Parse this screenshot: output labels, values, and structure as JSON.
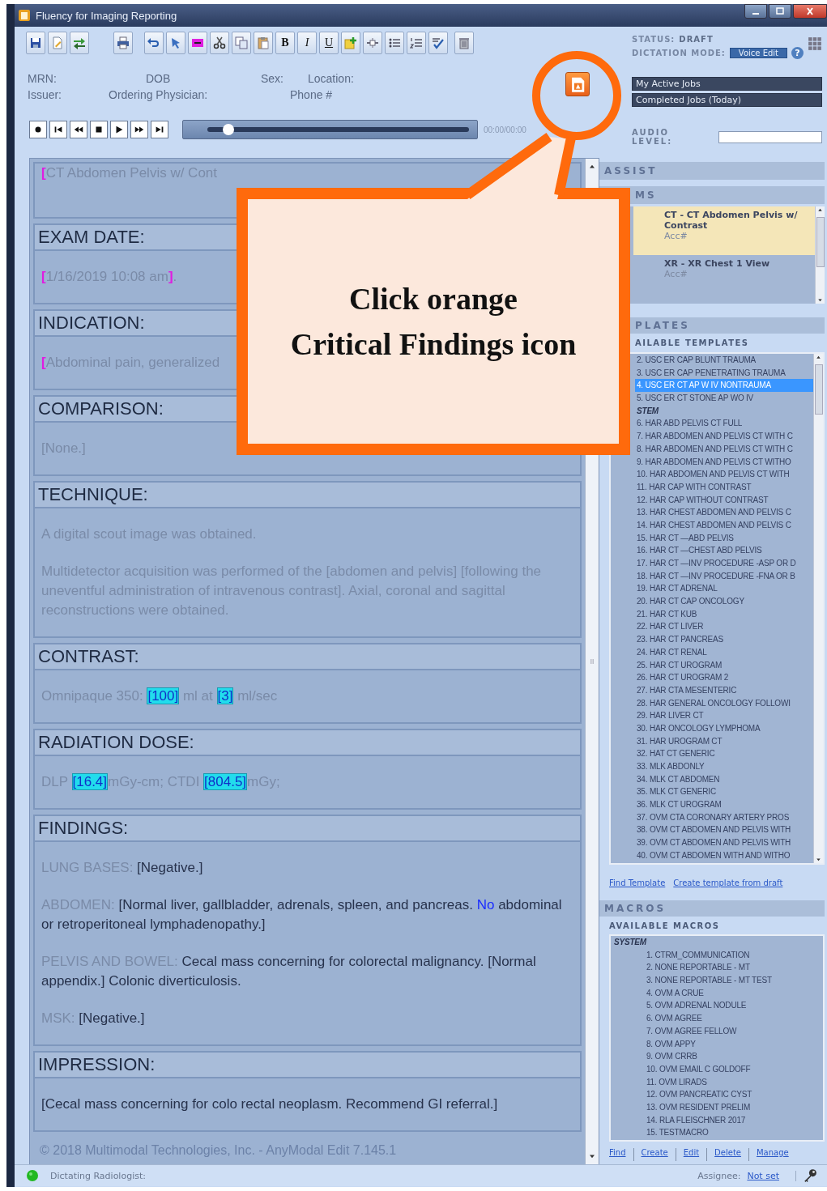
{
  "window": {
    "title": "Fluency for Imaging Reporting"
  },
  "toolbar": {
    "format_buttons": [
      "B",
      "I",
      "U"
    ]
  },
  "status": {
    "status_label": "STATUS:",
    "status_value": "DRAFT",
    "mode_label": "DICTATION MODE:",
    "mode_button": "Voice Edit",
    "help": "?"
  },
  "patient": {
    "rows": [
      [
        "MRN:",
        "DOB",
        "Sex:",
        "Location:"
      ],
      [
        "Issuer:",
        "Ordering Physician:",
        "Phone #"
      ]
    ]
  },
  "jobs": [
    {
      "label": "My Active Jobs"
    },
    {
      "label": "Completed Jobs (Today)"
    }
  ],
  "transport": {
    "level": 0.08,
    "time": "00:00/00:00"
  },
  "audio": {
    "label": "AUDIO LEVEL:"
  },
  "editor": {
    "title": [
      {
        "kind": "marker",
        "text": "["
      },
      {
        "kind": "prompt",
        "text": "CT Abdomen Pelvis w/ Cont"
      }
    ],
    "sections": [
      {
        "heading": "EXAM DATE:",
        "paragraphs": [
          [
            {
              "kind": "marker",
              "text": "["
            },
            {
              "kind": "prompt",
              "text": "1/16/2019 10:08 am"
            },
            {
              "kind": "marker",
              "text": "]"
            },
            {
              "kind": "prompt",
              "text": "."
            }
          ]
        ]
      },
      {
        "heading": "INDICATION:",
        "paragraphs": [
          [
            {
              "kind": "marker",
              "text": "["
            },
            {
              "kind": "prompt",
              "text": "Abdominal pain, generalized"
            }
          ]
        ]
      },
      {
        "heading": "COMPARISON:",
        "paragraphs": [
          [
            {
              "kind": "prompt",
              "text": "[None.]"
            }
          ]
        ]
      },
      {
        "heading": "TECHNIQUE:",
        "paragraphs": [
          [
            {
              "kind": "prompt",
              "text": "A digital scout image was obtained."
            }
          ],
          [
            {
              "kind": "prompt",
              "text": "Multidetector acquisition was performed of the [abdomen and pelvis] [following the uneventful administration of intravenous contrast].  Axial, coronal and sagittal reconstructions were obtained."
            }
          ]
        ]
      },
      {
        "heading": "CONTRAST:",
        "paragraphs": [
          [
            {
              "kind": "prompt",
              "text": "Omnipaque 350: "
            },
            {
              "kind": "box",
              "text": "[100]"
            },
            {
              "kind": "prompt",
              "text": " ml at "
            },
            {
              "kind": "box",
              "text": "[3]"
            },
            {
              "kind": "prompt",
              "text": " ml/sec"
            }
          ]
        ]
      },
      {
        "heading": "RADIATION DOSE:",
        "paragraphs": [
          [
            {
              "kind": "prompt",
              "text": "DLP "
            },
            {
              "kind": "box",
              "text": "[16.4]"
            },
            {
              "kind": "prompt",
              "text": "mGy-cm; CTDI "
            },
            {
              "kind": "box",
              "text": "[804.5]"
            },
            {
              "kind": "prompt",
              "text": "mGy;"
            }
          ]
        ]
      },
      {
        "heading": "FINDINGS:",
        "paragraphs": [
          [
            {
              "kind": "prompt",
              "text": "LUNG BASES: "
            },
            {
              "kind": "value",
              "text": "[Negative.]"
            }
          ],
          [
            {
              "kind": "prompt",
              "text": "ABDOMEN: "
            },
            {
              "kind": "value",
              "text": "[Normal liver, gallbladder, adrenals, spleen, and pancreas.  "
            },
            {
              "kind": "accent",
              "text": "No"
            },
            {
              "kind": "value",
              "text": " abdominal or retroperitoneal lymphadenopathy.]"
            }
          ],
          [
            {
              "kind": "prompt",
              "text": "PELVIS AND BOWEL: "
            },
            {
              "kind": "value",
              "text": "Cecal mass concerning for colorectal malignancy. [Normal appendix.]  Colonic diverticulosis."
            }
          ],
          [
            {
              "kind": "prompt",
              "text": "MSK: "
            },
            {
              "kind": "value",
              "text": "[Negative.]"
            }
          ]
        ]
      },
      {
        "heading": "IMPRESSION:",
        "paragraphs": [
          [
            {
              "kind": "value",
              "text": "[Cecal mass concerning for colo rectal neoplasm.  Recommend GI referral.]"
            }
          ]
        ]
      }
    ],
    "footer": "© 2018 Multimodal Technologies, Inc. - AnyModal Edit 7.145.1"
  },
  "assist": {
    "header": "ASSIST",
    "exams_header": "MS",
    "exams": [
      {
        "title": "CT - CT Abdomen Pelvis w/ Contrast",
        "acc": "Acc#",
        "selected": true
      },
      {
        "title": "XR - XR Chest 1 View",
        "acc": "Acc#",
        "selected": false
      }
    ],
    "templates_header": "PLATES",
    "available_label": "AILABLE TEMPLATES",
    "templates": [
      {
        "kind": "item",
        "text": "2. USC ER CAP BLUNT TRAUMA",
        "selected": false
      },
      {
        "kind": "item",
        "text": "3. USC ER CAP PENETRATING TRAUMA",
        "selected": false
      },
      {
        "kind": "item",
        "text": "4. USC ER CT AP W IV NONTRAUMA",
        "selected": true
      },
      {
        "kind": "item",
        "text": "5. USC ER CT STONE AP WO IV",
        "selected": false
      },
      {
        "kind": "group",
        "text": "STEM"
      },
      {
        "kind": "item",
        "text": "6. HAR ABD PELVIS CT FULL",
        "selected": false
      },
      {
        "kind": "item",
        "text": "7. HAR ABDOMEN AND PELVIS CT WITH C",
        "selected": false
      },
      {
        "kind": "item",
        "text": "8. HAR ABDOMEN AND PELVIS CT WITH C",
        "selected": false
      },
      {
        "kind": "item",
        "text": "9. HAR ABDOMEN AND PELVIS CT WITHO",
        "selected": false
      },
      {
        "kind": "item",
        "text": "10. HAR ABDOMEN AND PELVIS CT WITH",
        "selected": false
      },
      {
        "kind": "item",
        "text": "11. HAR CAP WITH CONTRAST",
        "selected": false
      },
      {
        "kind": "item",
        "text": "12. HAR CAP WITHOUT CONTRAST",
        "selected": false
      },
      {
        "kind": "item",
        "text": "13. HAR CHEST ABDOMEN AND PELVIS C",
        "selected": false
      },
      {
        "kind": "item",
        "text": "14. HAR CHEST ABDOMEN AND PELVIS C",
        "selected": false
      },
      {
        "kind": "item",
        "text": "15. HAR CT —ABD PELVIS",
        "selected": false
      },
      {
        "kind": "item",
        "text": "16. HAR CT —CHEST ABD PELVIS",
        "selected": false
      },
      {
        "kind": "item",
        "text": "17. HAR CT —INV PROCEDURE -ASP OR D",
        "selected": false
      },
      {
        "kind": "item",
        "text": "18. HAR CT —INV PROCEDURE -FNA OR B",
        "selected": false
      },
      {
        "kind": "item",
        "text": "19. HAR CT ADRENAL",
        "selected": false
      },
      {
        "kind": "item",
        "text": "20. HAR CT CAP ONCOLOGY",
        "selected": false
      },
      {
        "kind": "item",
        "text": "21. HAR CT KUB",
        "selected": false
      },
      {
        "kind": "item",
        "text": "22. HAR CT LIVER",
        "selected": false
      },
      {
        "kind": "item",
        "text": "23. HAR CT PANCREAS",
        "selected": false
      },
      {
        "kind": "item",
        "text": "24. HAR CT RENAL",
        "selected": false
      },
      {
        "kind": "item",
        "text": "25. HAR CT UROGRAM",
        "selected": false
      },
      {
        "kind": "item",
        "text": "26. HAR CT UROGRAM 2",
        "selected": false
      },
      {
        "kind": "item",
        "text": "27. HAR CTA MESENTERIC",
        "selected": false
      },
      {
        "kind": "item",
        "text": "28. HAR GENERAL ONCOLOGY FOLLOWI",
        "selected": false
      },
      {
        "kind": "item",
        "text": "29. HAR LIVER CT",
        "selected": false
      },
      {
        "kind": "item",
        "text": "30. HAR ONCOLOGY LYMPHOMA",
        "selected": false
      },
      {
        "kind": "item",
        "text": "31. HAR UROGRAM CT",
        "selected": false
      },
      {
        "kind": "item",
        "text": "32. HAT CT GENERIC",
        "selected": false
      },
      {
        "kind": "item",
        "text": "33. MLK ABDONLY",
        "selected": false
      },
      {
        "kind": "item",
        "text": "34. MLK CT ABDOMEN",
        "selected": false
      },
      {
        "kind": "item",
        "text": "35. MLK CT GENERIC",
        "selected": false
      },
      {
        "kind": "item",
        "text": "36. MLK CT UROGRAM",
        "selected": false
      },
      {
        "kind": "item",
        "text": "37. OVM CTA CORONARY ARTERY PROS",
        "selected": false
      },
      {
        "kind": "item",
        "text": "38. OVM CT ABDOMEN AND PELVIS WITH",
        "selected": false
      },
      {
        "kind": "item",
        "text": "39. OVM CT ABDOMEN AND PELVIS WITH",
        "selected": false
      },
      {
        "kind": "item",
        "text": "40. OVM CT ABDOMEN WITH AND WITHO",
        "selected": false
      }
    ],
    "template_links": [
      "Find Template",
      "Create template from draft"
    ],
    "macros_header": "MACROS",
    "macros_label": "AVAILABLE MACROS",
    "macros": [
      {
        "kind": "group",
        "text": "SYSTEM"
      },
      {
        "kind": "item",
        "text": "1. CTRM_COMMUNICATION",
        "selected": false
      },
      {
        "kind": "item",
        "text": "2. NONE REPORTABLE - MT",
        "selected": false
      },
      {
        "kind": "item",
        "text": "3. NONE REPORTABLE - MT TEST",
        "selected": false
      },
      {
        "kind": "item",
        "text": "4. OVM A CRUE",
        "selected": false
      },
      {
        "kind": "item",
        "text": "5. OVM ADRENAL NODULE",
        "selected": false
      },
      {
        "kind": "item",
        "text": "6. OVM AGREE",
        "selected": false
      },
      {
        "kind": "item",
        "text": "7. OVM AGREE FELLOW",
        "selected": false
      },
      {
        "kind": "item",
        "text": "8. OVM APPY",
        "selected": false
      },
      {
        "kind": "item",
        "text": "9. OVM CRRB",
        "selected": false
      },
      {
        "kind": "item",
        "text": "10. OVM EMAIL C GOLDOFF",
        "selected": false
      },
      {
        "kind": "item",
        "text": "11. OVM LIRADS",
        "selected": false
      },
      {
        "kind": "item",
        "text": "12. OVM PANCREATIC CYST",
        "selected": false
      },
      {
        "kind": "item",
        "text": "13. OVM RESIDENT PRELIM",
        "selected": false
      },
      {
        "kind": "item",
        "text": "14. RLA FLEISCHNER 2017",
        "selected": false
      },
      {
        "kind": "item",
        "text": "15. TESTMACRO",
        "selected": false
      }
    ],
    "macro_links": [
      "Find",
      "Create",
      "Edit",
      "Delete",
      "Manage"
    ]
  },
  "status_bar": {
    "label": "Dictating Radiologist:",
    "assignee_label": "Assignee:",
    "assignee_value": "Not set"
  },
  "callout": {
    "text": "Click orange\nCritical Findings icon"
  }
}
